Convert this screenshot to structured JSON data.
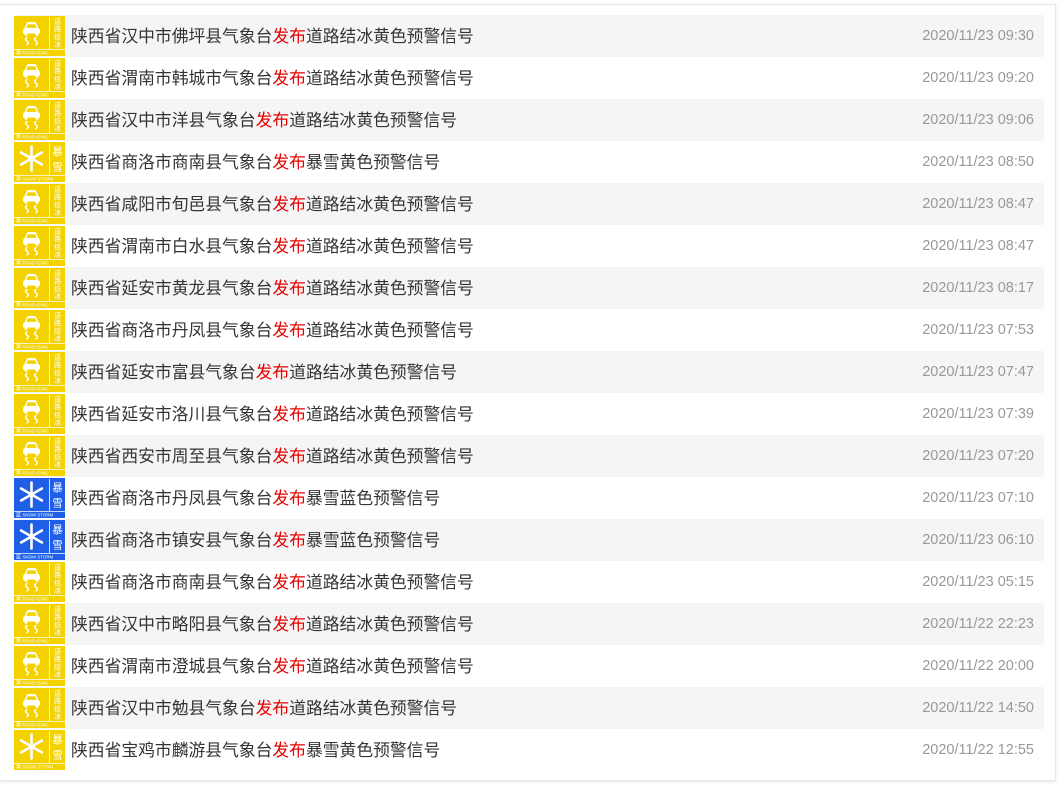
{
  "colors": {
    "text": "#333333",
    "issue_verb": "#e60000",
    "time": "#999999",
    "row_alt_background": "#f5f5f5",
    "warning_yellow": "#f4d200",
    "warning_blue": "#1f5fe8"
  },
  "signal_icons": {
    "road-icing-yellow": {
      "symbol": "car-skid-icon",
      "color": "#f4d200",
      "name_text": "道路结冰",
      "level_text": "黄",
      "english_text": "ROAD ICING"
    },
    "snowstorm-yellow": {
      "symbol": "snowflake-icon",
      "color": "#f4d200",
      "name_text": "暴雪",
      "level_text": "黄",
      "english_text": "SNOW STORM"
    },
    "snowstorm-blue": {
      "symbol": "snowflake-icon",
      "color": "#1f5fe8",
      "name_text": "暴雪",
      "level_text": "蓝",
      "english_text": "SNOW STORM"
    }
  },
  "warnings": [
    {
      "icon": "road-icing-yellow",
      "issuer": "陕西省汉中市佛坪县气象台",
      "verb": "发布",
      "signal": "道路结冰黄色预警信号",
      "time": "2020/11/23 09:30"
    },
    {
      "icon": "road-icing-yellow",
      "issuer": "陕西省渭南市韩城市气象台",
      "verb": "发布",
      "signal": "道路结冰黄色预警信号",
      "time": "2020/11/23 09:20"
    },
    {
      "icon": "road-icing-yellow",
      "issuer": "陕西省汉中市洋县气象台",
      "verb": "发布",
      "signal": "道路结冰黄色预警信号",
      "time": "2020/11/23 09:06"
    },
    {
      "icon": "snowstorm-yellow",
      "issuer": "陕西省商洛市商南县气象台",
      "verb": "发布",
      "signal": "暴雪黄色预警信号",
      "time": "2020/11/23 08:50"
    },
    {
      "icon": "road-icing-yellow",
      "issuer": "陕西省咸阳市旬邑县气象台",
      "verb": "发布",
      "signal": "道路结冰黄色预警信号",
      "time": "2020/11/23 08:47"
    },
    {
      "icon": "road-icing-yellow",
      "issuer": "陕西省渭南市白水县气象台",
      "verb": "发布",
      "signal": "道路结冰黄色预警信号",
      "time": "2020/11/23 08:47"
    },
    {
      "icon": "road-icing-yellow",
      "issuer": "陕西省延安市黄龙县气象台",
      "verb": "发布",
      "signal": "道路结冰黄色预警信号",
      "time": "2020/11/23 08:17"
    },
    {
      "icon": "road-icing-yellow",
      "issuer": "陕西省商洛市丹凤县气象台",
      "verb": "发布",
      "signal": "道路结冰黄色预警信号",
      "time": "2020/11/23 07:53"
    },
    {
      "icon": "road-icing-yellow",
      "issuer": "陕西省延安市富县气象台",
      "verb": "发布",
      "signal": "道路结冰黄色预警信号",
      "time": "2020/11/23 07:47"
    },
    {
      "icon": "road-icing-yellow",
      "issuer": "陕西省延安市洛川县气象台",
      "verb": "发布",
      "signal": "道路结冰黄色预警信号",
      "time": "2020/11/23 07:39"
    },
    {
      "icon": "road-icing-yellow",
      "issuer": "陕西省西安市周至县气象台",
      "verb": "发布",
      "signal": "道路结冰黄色预警信号",
      "time": "2020/11/23 07:20"
    },
    {
      "icon": "snowstorm-blue",
      "issuer": "陕西省商洛市丹凤县气象台",
      "verb": "发布",
      "signal": "暴雪蓝色预警信号",
      "time": "2020/11/23 07:10"
    },
    {
      "icon": "snowstorm-blue",
      "issuer": "陕西省商洛市镇安县气象台",
      "verb": "发布",
      "signal": "暴雪蓝色预警信号",
      "time": "2020/11/23 06:10"
    },
    {
      "icon": "road-icing-yellow",
      "issuer": "陕西省商洛市商南县气象台",
      "verb": "发布",
      "signal": "道路结冰黄色预警信号",
      "time": "2020/11/23 05:15"
    },
    {
      "icon": "road-icing-yellow",
      "issuer": "陕西省汉中市略阳县气象台",
      "verb": "发布",
      "signal": "道路结冰黄色预警信号",
      "time": "2020/11/22 22:23"
    },
    {
      "icon": "road-icing-yellow",
      "issuer": "陕西省渭南市澄城县气象台",
      "verb": "发布",
      "signal": "道路结冰黄色预警信号",
      "time": "2020/11/22 20:00"
    },
    {
      "icon": "road-icing-yellow",
      "issuer": "陕西省汉中市勉县气象台",
      "verb": "发布",
      "signal": "道路结冰黄色预警信号",
      "time": "2020/11/22 14:50"
    },
    {
      "icon": "snowstorm-yellow",
      "issuer": "陕西省宝鸡市麟游县气象台",
      "verb": "发布",
      "signal": "暴雪黄色预警信号",
      "time": "2020/11/22 12:55"
    }
  ]
}
